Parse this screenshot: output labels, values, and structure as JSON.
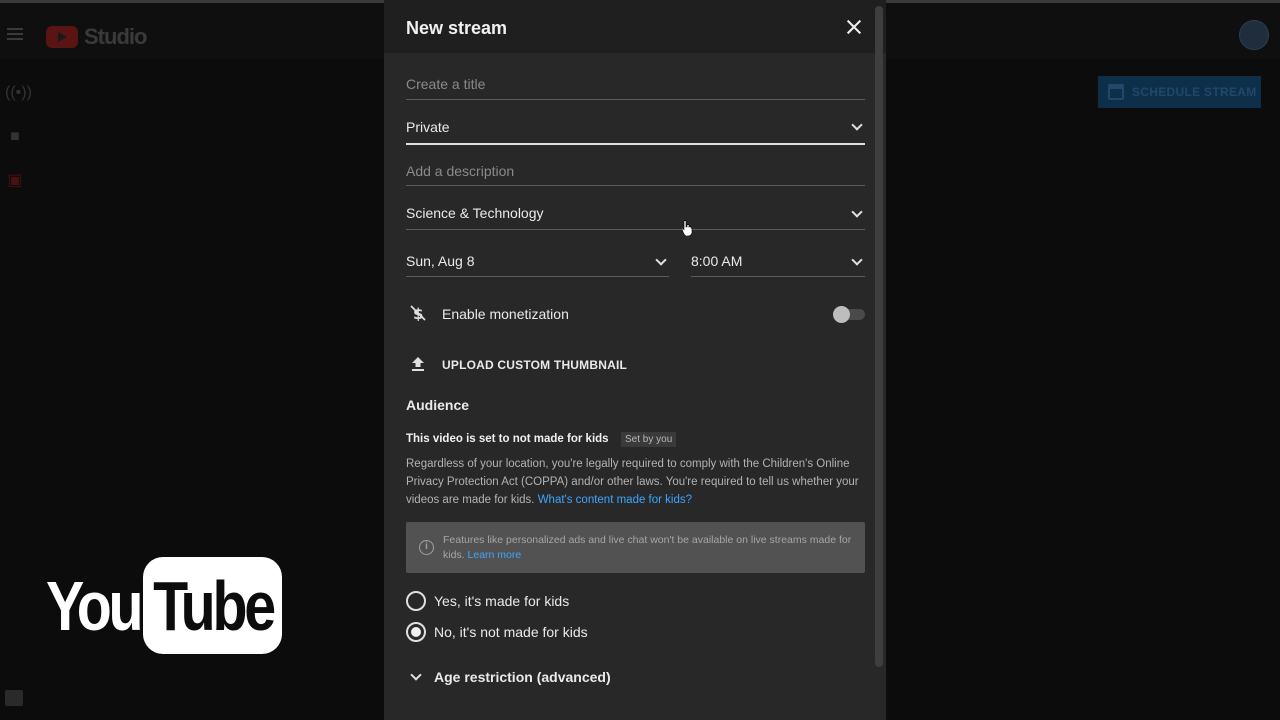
{
  "app": {
    "name": "Studio"
  },
  "header": {
    "schedule_button": "SCHEDULE STREAM"
  },
  "dialog": {
    "title": "New stream",
    "title_placeholder": "Create a title",
    "visibility": "Private",
    "description_placeholder": "Add a description",
    "category": "Science & Technology",
    "date": "Sun, Aug 8",
    "time": "8:00 AM",
    "monetization_label": "Enable monetization",
    "monetization_enabled": false,
    "upload_thumbnail": "UPLOAD CUSTOM THUMBNAIL",
    "audience": {
      "heading": "Audience",
      "status": "This video is set to not made for kids",
      "chip": "Set by you",
      "body": "Regardless of your location, you're legally required to comply with the Children's Online Privacy Protection Act (COPPA) and/or other laws. You're required to tell us whether your videos are made for kids.",
      "body_link": "What's content made for kids?",
      "notice": "Features like personalized ads and live chat won't be available on live streams made for kids.",
      "notice_link": "Learn more",
      "options": [
        {
          "label": "Yes, it's made for kids",
          "checked": false
        },
        {
          "label": "No, it's not made for kids",
          "checked": true
        }
      ]
    },
    "age_restriction": "Age restriction (advanced)"
  },
  "watermark": {
    "you": "You",
    "tube": "Tube"
  },
  "colors": {
    "dialog_bg": "#282828",
    "link": "#3ea6ff",
    "accent_red": "#ff0000"
  }
}
